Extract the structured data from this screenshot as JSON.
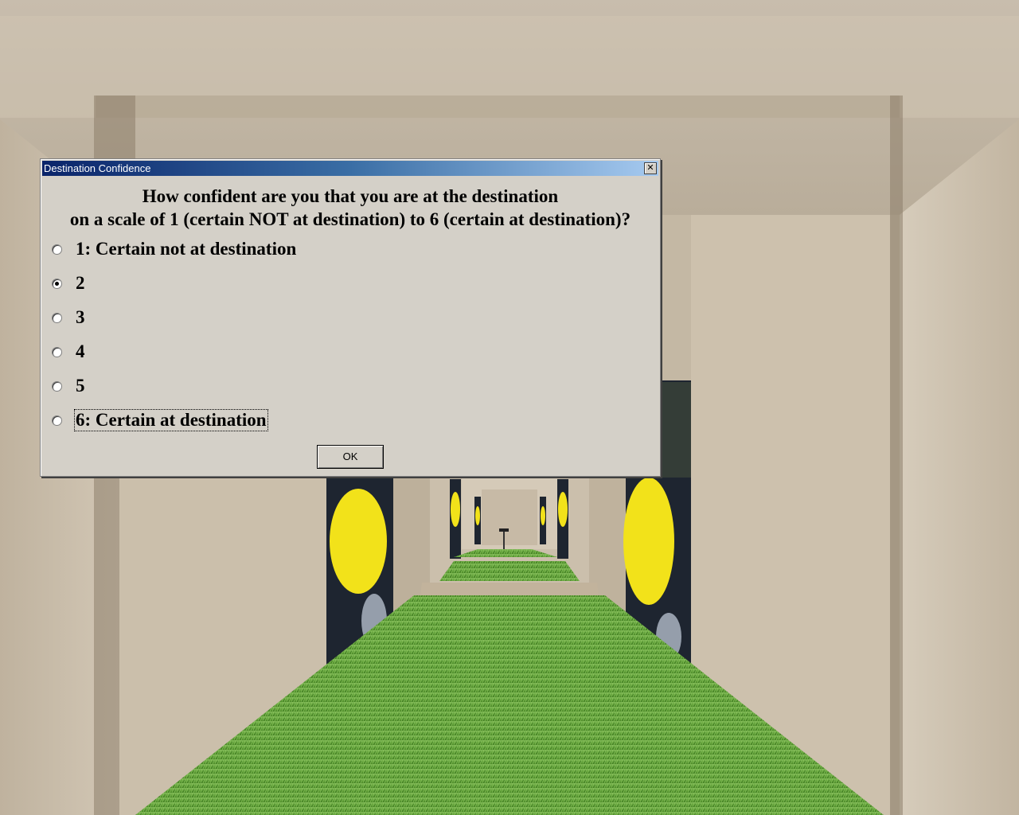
{
  "dialog": {
    "title": "Destination Confidence",
    "close_glyph": "✕",
    "question_line1": "How confident are you that you are at the destination",
    "question_line2": "on a scale of 1 (certain NOT at destination) to 6 (certain at destination)?",
    "options": [
      {
        "label": "1: Certain not at destination",
        "checked": false
      },
      {
        "label": "2",
        "checked": true
      },
      {
        "label": "3",
        "checked": false
      },
      {
        "label": "4",
        "checked": false
      },
      {
        "label": "5",
        "checked": false
      },
      {
        "label": "6: Certain at destination",
        "checked": false,
        "focused": true
      }
    ],
    "ok_label": "OK"
  },
  "colors": {
    "dialog_bg": "#d4d0c8",
    "titlebar_start": "#0a246a",
    "titlebar_end": "#a6caf0",
    "grass": "#4f8f2a",
    "wall": "#c9bca8",
    "poster_yellow": "#f2e21a"
  }
}
